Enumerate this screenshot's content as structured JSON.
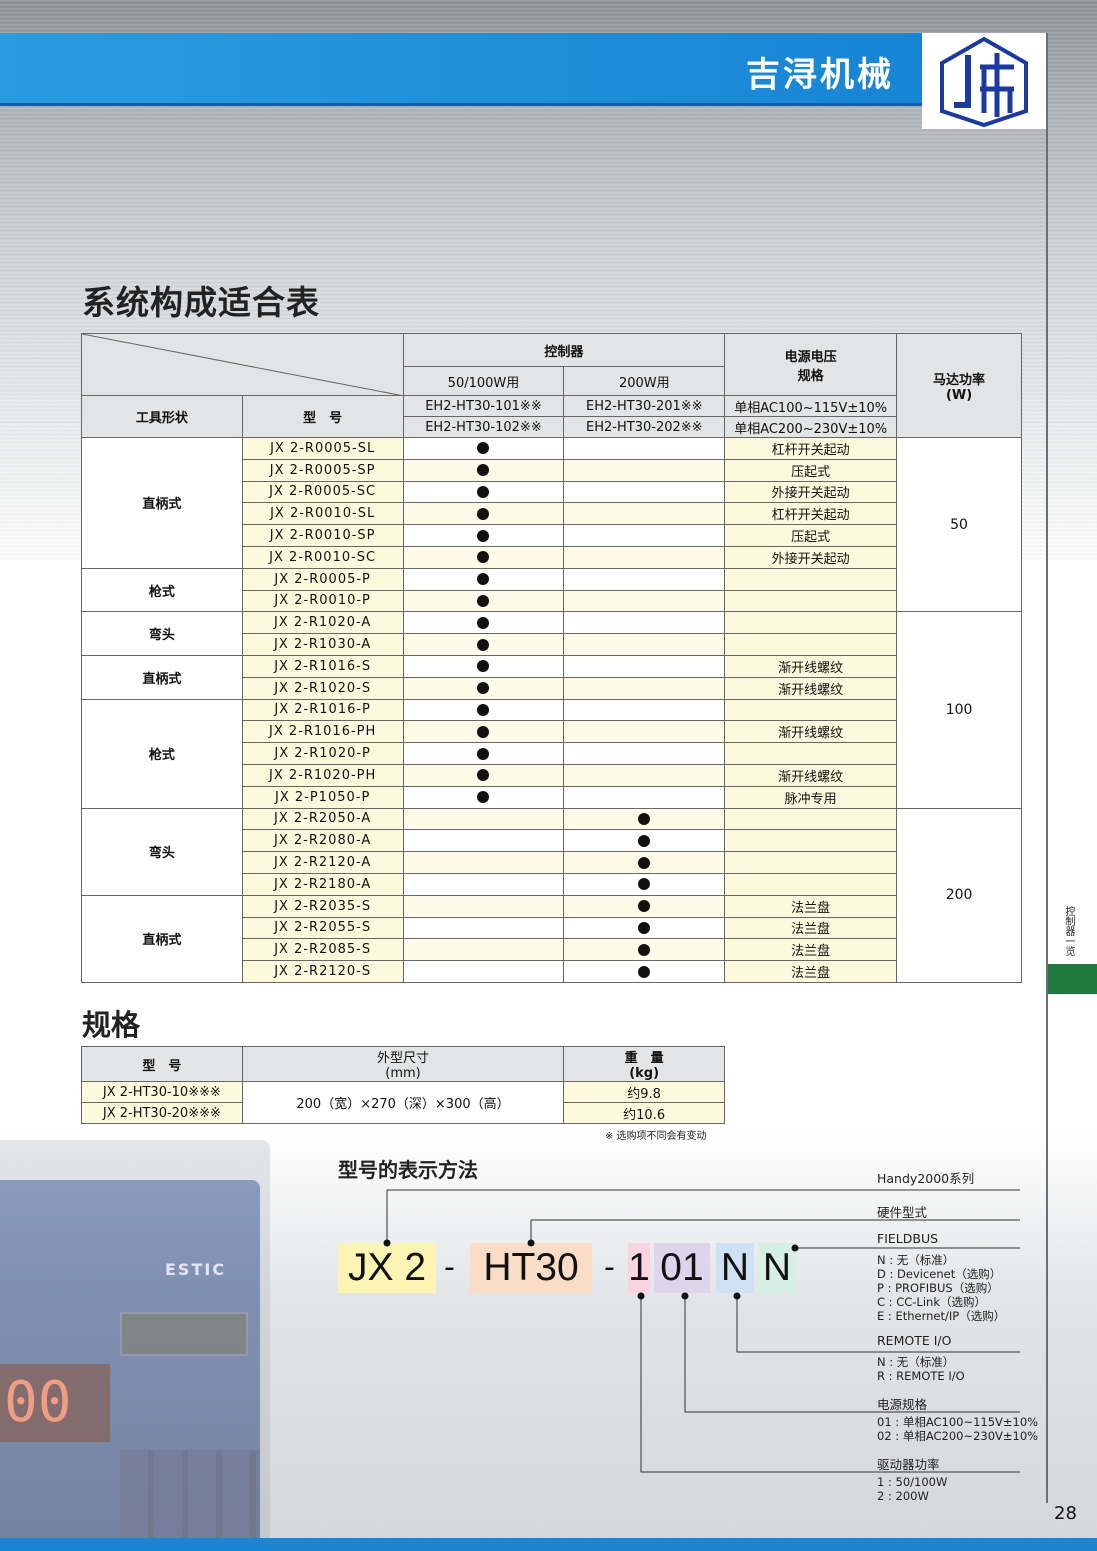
{
  "header": {
    "brand": "吉浔机械"
  },
  "side_tab": "控制器一览",
  "page_number": "28",
  "compat_table": {
    "title": "系统构成适合表",
    "head": {
      "controller": "控制器",
      "col_50_100": "50/100W用",
      "col_200": "200W用",
      "power_spec": "电源电压\n规格",
      "motor_power": "马达功率\n(W)",
      "tool_shape": "工具形状",
      "model": "型　号",
      "ctrl_101": "EH2-HT30-101※※",
      "ctrl_102": "EH2-HT30-102※※",
      "ctrl_201": "EH2-HT30-201※※",
      "ctrl_202": "EH2-HT30-202※※",
      "volt_1": "单相AC100~115V±10%",
      "volt_2": "单相AC200~230V±10%"
    },
    "rows": [
      {
        "model": "JX 2-R0005-SL",
        "c1": true,
        "c2": false,
        "note": "杠杆开关起动"
      },
      {
        "model": "JX 2-R0005-SP",
        "c1": true,
        "c2": false,
        "note": "压起式"
      },
      {
        "model": "JX 2-R0005-SC",
        "c1": true,
        "c2": false,
        "note": "外接开关起动"
      },
      {
        "model": "JX 2-R0010-SL",
        "c1": true,
        "c2": false,
        "note": "杠杆开关起动"
      },
      {
        "model": "JX 2-R0010-SP",
        "c1": true,
        "c2": false,
        "note": "压起式"
      },
      {
        "model": "JX 2-R0010-SC",
        "c1": true,
        "c2": false,
        "note": "外接开关起动"
      },
      {
        "model": "JX 2-R0005-P",
        "c1": true,
        "c2": false,
        "note": ""
      },
      {
        "model": "JX 2-R0010-P",
        "c1": true,
        "c2": false,
        "note": ""
      },
      {
        "model": "JX 2-R1020-A",
        "c1": true,
        "c2": false,
        "note": ""
      },
      {
        "model": "JX 2-R1030-A",
        "c1": true,
        "c2": false,
        "note": ""
      },
      {
        "model": "JX 2-R1016-S",
        "c1": true,
        "c2": false,
        "note": "渐开线螺纹"
      },
      {
        "model": "JX 2-R1020-S",
        "c1": true,
        "c2": false,
        "note": "渐开线螺纹"
      },
      {
        "model": "JX 2-R1016-P",
        "c1": true,
        "c2": false,
        "note": ""
      },
      {
        "model": "JX 2-R1016-PH",
        "c1": true,
        "c2": false,
        "note": "渐开线螺纹"
      },
      {
        "model": "JX 2-R1020-P",
        "c1": true,
        "c2": false,
        "note": ""
      },
      {
        "model": "JX 2-R1020-PH",
        "c1": true,
        "c2": false,
        "note": "渐开线螺纹"
      },
      {
        "model": "JX 2-P1050-P",
        "c1": true,
        "c2": false,
        "note": "脉冲专用"
      },
      {
        "model": "JX 2-R2050-A",
        "c1": false,
        "c2": true,
        "note": ""
      },
      {
        "model": "JX 2-R2080-A",
        "c1": false,
        "c2": true,
        "note": ""
      },
      {
        "model": "JX 2-R2120-A",
        "c1": false,
        "c2": true,
        "note": ""
      },
      {
        "model": "JX 2-R2180-A",
        "c1": false,
        "c2": true,
        "note": ""
      },
      {
        "model": "JX 2-R2035-S",
        "c1": false,
        "c2": true,
        "note": "法兰盘"
      },
      {
        "model": "JX 2-R2055-S",
        "c1": false,
        "c2": true,
        "note": "法兰盘"
      },
      {
        "model": "JX 2-R2085-S",
        "c1": false,
        "c2": true,
        "note": "法兰盘"
      },
      {
        "model": "JX 2-R2120-S",
        "c1": false,
        "c2": true,
        "note": "法兰盘"
      }
    ],
    "type_groups": [
      {
        "label": "直柄式",
        "span": 6
      },
      {
        "label": "枪式",
        "span": 2
      },
      {
        "label": "弯头",
        "span": 2
      },
      {
        "label": "直柄式",
        "span": 2
      },
      {
        "label": "枪式",
        "span": 5
      },
      {
        "label": "弯头",
        "span": 4
      },
      {
        "label": "直柄式",
        "span": 4
      }
    ],
    "motor_groups": [
      {
        "label": "50",
        "span": 8
      },
      {
        "label": "100",
        "span": 9
      },
      {
        "label": "200",
        "span": 8
      }
    ]
  },
  "spec_table": {
    "title": "规格",
    "head": {
      "model": "型　号",
      "dims": "外型尺寸\n(mm)",
      "weight": "重　量\n(kg)"
    },
    "rows": [
      {
        "model": "JX 2-HT30-10※※※",
        "weight": "约9.8"
      },
      {
        "model": "JX 2-HT30-20※※※",
        "weight": "约10.6"
      }
    ],
    "dims_value": "200（宽）×270（深）×300（高）",
    "note": "※ 选购项不同会有变动"
  },
  "device_photo": {
    "logo": "ESTIC",
    "display": "00"
  },
  "model_code": {
    "title": "型号的表示方法",
    "segments": {
      "s1": "JX 2",
      "s2": "HT30",
      "s3": "1",
      "s4": "01",
      "s5": "N",
      "s6": "N",
      "dash": "-"
    },
    "colors": {
      "s1": "#fbf4b3",
      "s2": "#fbdcc7",
      "s3": "#f9d6df",
      "s4": "#dcd5ec",
      "s5": "#cfe1f4",
      "s6": "#d5eee6"
    },
    "annotations": {
      "series": "Handy2000系列",
      "hardware": "硬件型式",
      "fieldbus": "FIELDBUS",
      "fieldbus_opts": [
        "N : 无（标准）",
        "D : Devicenet（选购）",
        "P : PROFIBUS（选购）",
        "C : CC-Link（选购）",
        "E : Ethernet/IP（选购）"
      ],
      "remote": "REMOTE I/O",
      "remote_opts": [
        "N : 无（标准）",
        "R : REMOTE I/O"
      ],
      "power": "电源规格",
      "power_opts": [
        "01 : 单相AC100~115V±10%",
        "02 : 单相AC200~230V±10%"
      ],
      "driver": "驱动器功率",
      "driver_opts": [
        "1 : 50/100W",
        "2 : 200W"
      ]
    }
  }
}
